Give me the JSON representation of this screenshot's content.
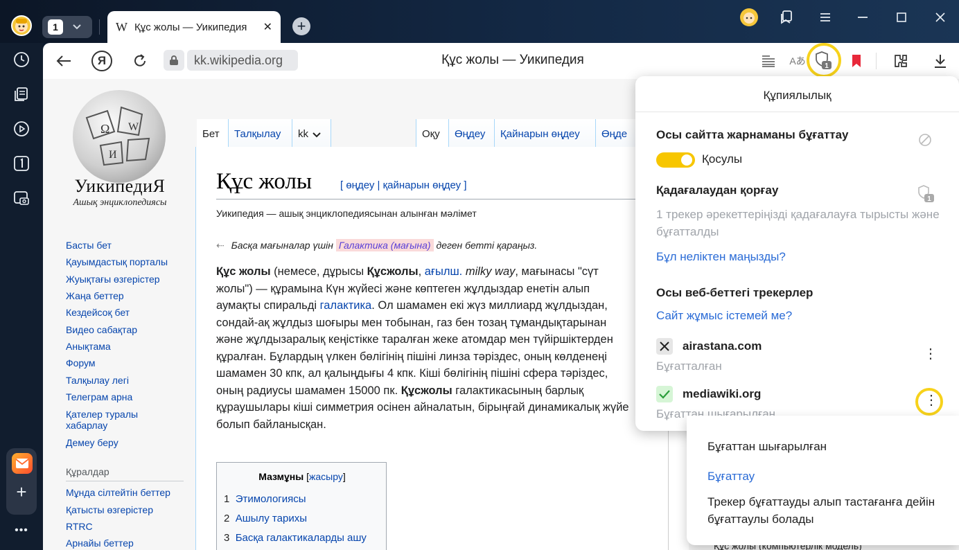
{
  "browser": {
    "tab_count": "1",
    "tab_title": "Құс жолы — Уикипедия",
    "tab_favicon": "W",
    "url": "kk.wikipedia.org",
    "page_title": "Құс жолы — Уикипедия",
    "shield_badge": "1",
    "bookmark_color": "#e8283a",
    "accent_yellow": "#f7d21b"
  },
  "wiki": {
    "logo_name": "УикипедиЯ",
    "logo_sub": "Ашық энциклопедиясы",
    "nav": [
      "Басты бет",
      "Қауымдастық порталы",
      "Жуықтағы өзгерістер",
      "Жаңа беттер",
      "Кездейсоқ бет",
      "Видео сабақтар",
      "Анықтама",
      "Форум",
      "Талқылау легі",
      "Телеграм арна",
      "Қателер туралы",
      "хабарлау",
      "Демеу беру"
    ],
    "tools_title": "Құралдар",
    "tools": [
      "Мұнда сілтейтін беттер",
      "Қатысты өзгерістер",
      "RTRC",
      "Арнайы беттер"
    ],
    "tabs": {
      "article": "Бет",
      "talk": "Талқылау",
      "lang": "kk",
      "read": "Оқу",
      "edit": "Өңдеу",
      "edit_source": "Қайнарын өңдеу",
      "edit_cut": "Өңде"
    },
    "heading": "Құс жолы",
    "heading_edit": "[ өңдеу | қайнарын өңдеу ]",
    "from": "Уикипедия — ашық энциклопедиясынан алынған мәлімет",
    "hatnote_pre": "Басқа мағыналар үшін",
    "hatnote_link": "Галактика (мағына)",
    "hatnote_post": "деген бетті қараңыз.",
    "body": {
      "l1_b": "Құс жолы",
      "l1_a": " (немесе, дұрысы ",
      "l1_b2": "Құсжолы",
      "l1_c": ", ",
      "l1_link": "ағылш.",
      "l1_d": " ",
      "l1_i": "milky way",
      "l1_e": ", мағынасы \"сүт",
      "l2": "жолы\") — құрамына Күн жүйесі және көптеген жұлдыздар енетін алып",
      "l3_a": "аумақты спиральді ",
      "l3_link": "галактика",
      "l3_b": ". Ол шамамен екі жүз миллиард жұлдыздан,",
      "l4": "сондай-ақ жұлдыз шоғыры мен тобынан, газ бен тозаң тұмандықтарынан",
      "l5": "және жұлдызаралық кеңістікке таралған жеке атомдар мен түйіршіктерден",
      "l6": "құралған. Бұлардың үлкен бөлігінің пішіні линза тәріздес, оның көлденеңі",
      "l7": "шамамен 30 кпк, ал қалыңдығы 4 кпк. Кіші бөлігінің пішіні сфера тәріздес,",
      "l8_a": "оның радиусы шамамен 15000 пк. ",
      "l8_b": "Құсжолы",
      "l8_c": " галактикасының барлық",
      "l9": "құраушылары кіші симметрия осінен айналатын, бірыңғай динамикалық жүйе",
      "l10": "болып байланысқан."
    },
    "toc": {
      "title": "Мазмұны",
      "toggle": "жасыру",
      "items": [
        {
          "num": "1",
          "label": "Этимологиясы"
        },
        {
          "num": "2",
          "label": "Ашылу тарихы"
        },
        {
          "num": "3",
          "label": "Басқа галактикаларды ашу"
        }
      ]
    },
    "bottom_peek": "Құс жолы (компьютерлік модель)"
  },
  "privacy": {
    "title": "Құпиялылық",
    "adblock_title": "Осы сайтта жарнаманы бұғаттау",
    "adblock_state": "Қосулы",
    "tracking_title": "Қадағалаудан қорғау",
    "tracking_badge": "1",
    "tracking_desc": "1 трекер әрекеттеріңізді қадағалауға тырысты және бұғатталды",
    "why_link": "Бұл неліктен маңызды?",
    "trackers_title": "Осы веб-беттегі трекерлер",
    "site_broken_link": "Сайт жұмыс істемей ме?",
    "trackers": [
      {
        "domain": "airastana.com",
        "status": "Бұғатталған",
        "icon": "cross-icon"
      },
      {
        "domain": "mediawiki.org",
        "status": "Бұғаттан шығарылған",
        "icon": "check-icon"
      }
    ],
    "toggle_color": "#f7c600",
    "link_color": "#2a6bd6"
  },
  "dropdown": {
    "unblocked": "Бұғаттан шығарылған",
    "block_action": "Бұғаттау",
    "note": "Трекер бұғаттауды алып тастағанға дейін бұғаттаулы болады"
  }
}
